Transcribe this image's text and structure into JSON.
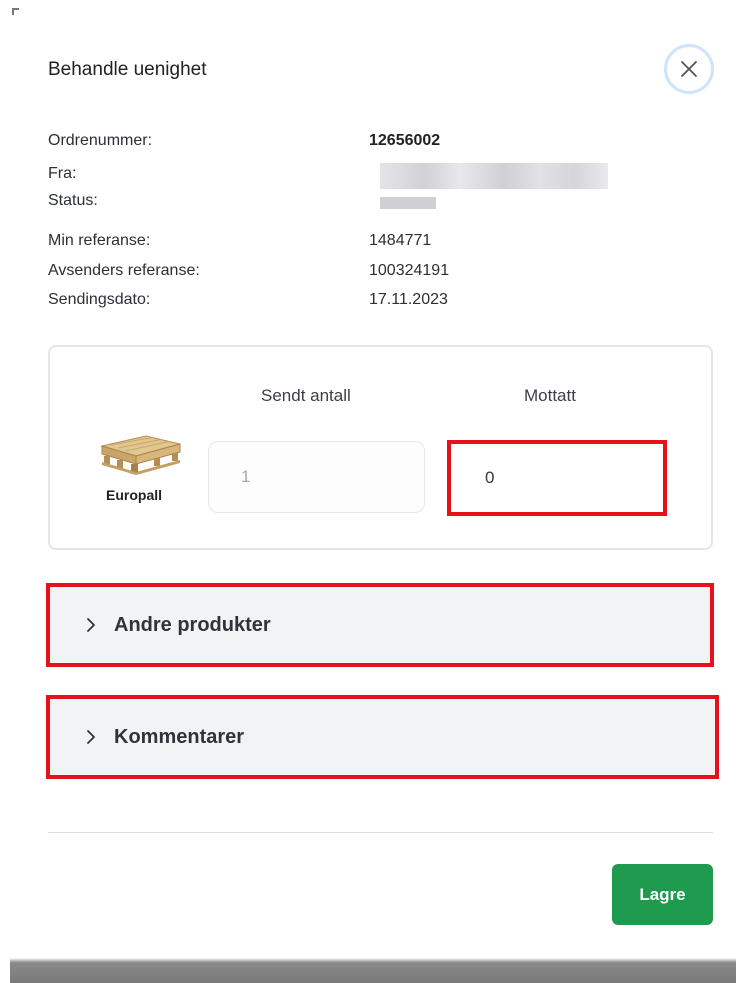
{
  "dialog": {
    "title": "Behandle uenighet"
  },
  "order_info": {
    "order_number_label": "Ordrenummer:",
    "order_number_value": "12656002",
    "from_label": "Fra:",
    "status_label": "Status:",
    "my_reference_label": "Min referanse:",
    "my_reference_value": "1484771",
    "sender_reference_label": "Avsenders referanse:",
    "sender_reference_value": "100324191",
    "shipping_date_label": "Sendingsdato:",
    "shipping_date_value": "17.11.2023"
  },
  "pallet_table": {
    "sent_header": "Sendt antall",
    "received_header": "Mottatt",
    "product_name": "Europall",
    "sent_value": "1",
    "received_value": "0"
  },
  "sections": {
    "other_products_label": "Andre produkter",
    "comments_label": "Kommentarer"
  },
  "actions": {
    "save_label": "Lagre"
  },
  "colors": {
    "accent_green": "#1f9b4f",
    "highlight_red": "#e8101a",
    "close_ring": "#cfe3fb"
  },
  "icons": {
    "close": "close-icon",
    "chevron": "chevron-right-icon"
  }
}
